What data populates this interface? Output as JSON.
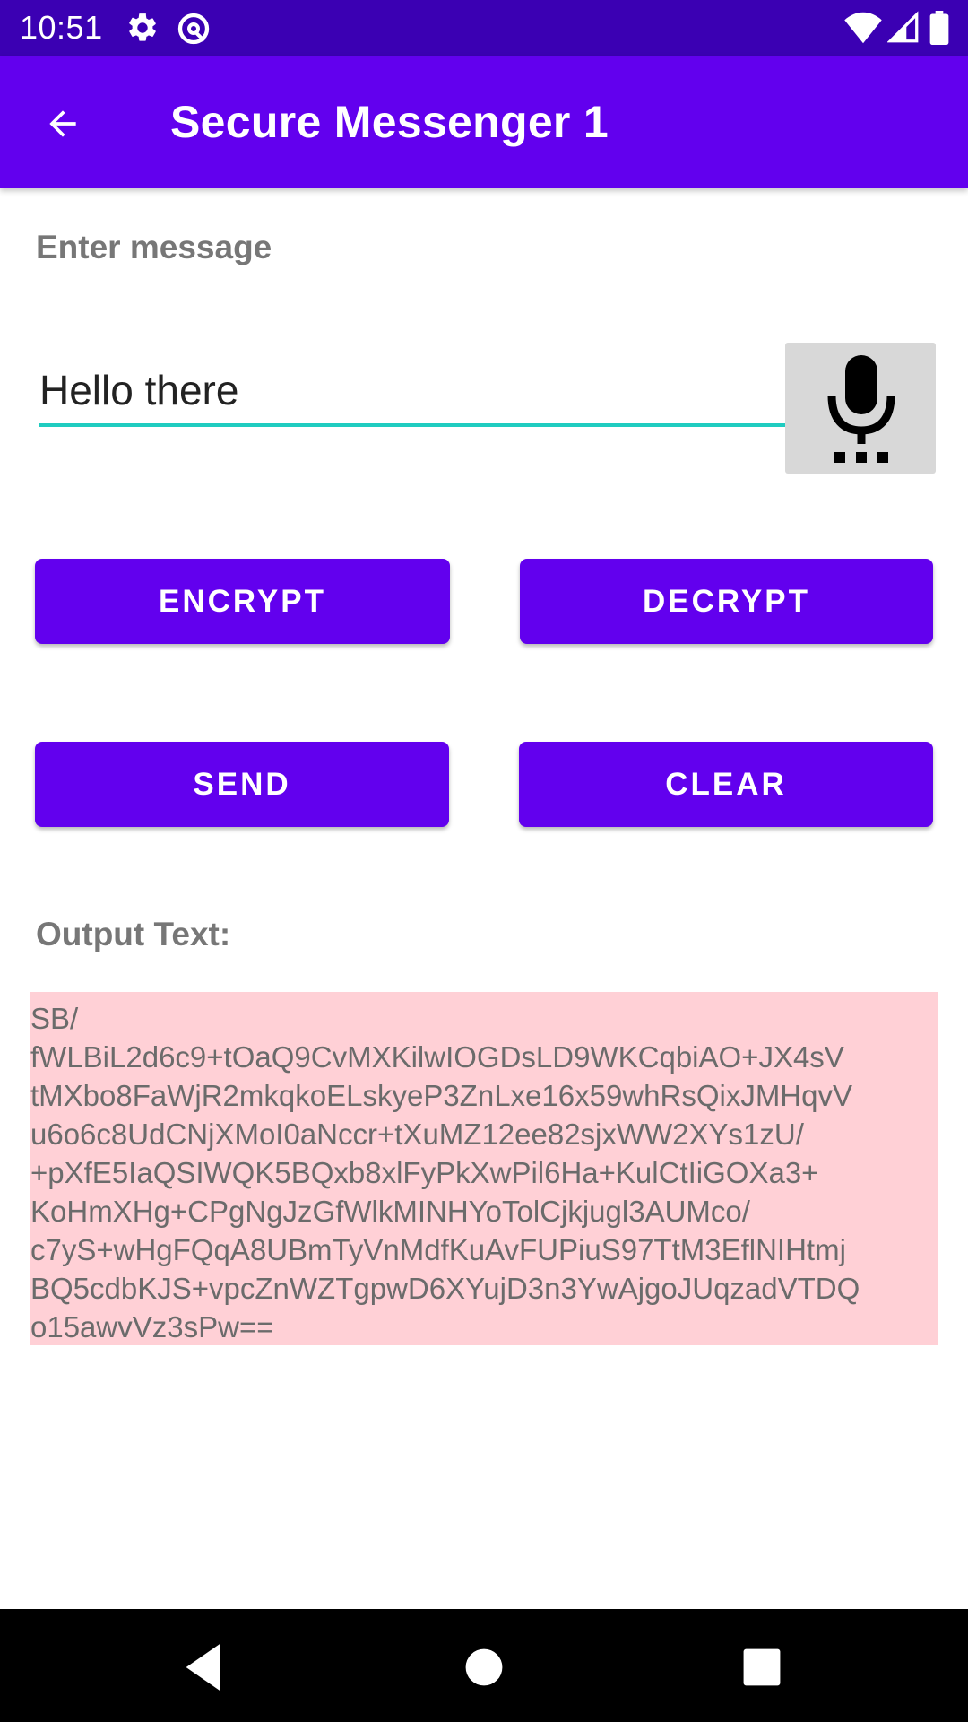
{
  "status_bar": {
    "time": "10:51",
    "icons": [
      "gear-icon",
      "at-sign-icon",
      "wifi-icon",
      "cell-signal-icon",
      "battery-icon"
    ]
  },
  "app_bar": {
    "title": "Secure Messenger 1",
    "back_icon": "arrow-back-icon",
    "color": "#6200ee"
  },
  "form": {
    "enter_message_label": "Enter message",
    "message_value": "Hello there",
    "mic_icon": "microphone-icon"
  },
  "buttons": {
    "encrypt": "ENCRYPT",
    "decrypt": "DECRYPT",
    "send": "SEND",
    "clear": "CLEAR"
  },
  "output": {
    "label": "Output Text:",
    "lines": [
      "SB/",
      "fWLBiL2d6c9+tOaQ9CvMXKilwIOGDsLD9WKCqbiAO+JX4sV",
      "tMXbo8FaWjR2mkqkoELskyeP3ZnLxe16x59whRsQixJMHqvV",
      "u6o6c8UdCNjXMoI0aNccr+tXuMZ12ee82sjxWW2XYs1zU/",
      "+pXfE5IaQSIWQK5BQxb8xlFyPkXwPil6Ha+KulCtIiGOXa3+",
      "KoHmXHg+CPgNgJzGfWlkMINHYoTolCjkjugl3AUMco/",
      "c7yS+wHgFQqA8UBmTyVnMdfKuAvFUPiuS97TtM3EflNIHtmj",
      "BQ5cdbKJS+vpcZnWZTgpwD6XYujD3n3YwAjgoJUqzadVTDQ",
      "o15awvVz3sPw=="
    ],
    "background": "#ffd0d6"
  },
  "nav_bar": {
    "icons": [
      "nav-back-icon",
      "nav-home-icon",
      "nav-recents-icon"
    ]
  }
}
